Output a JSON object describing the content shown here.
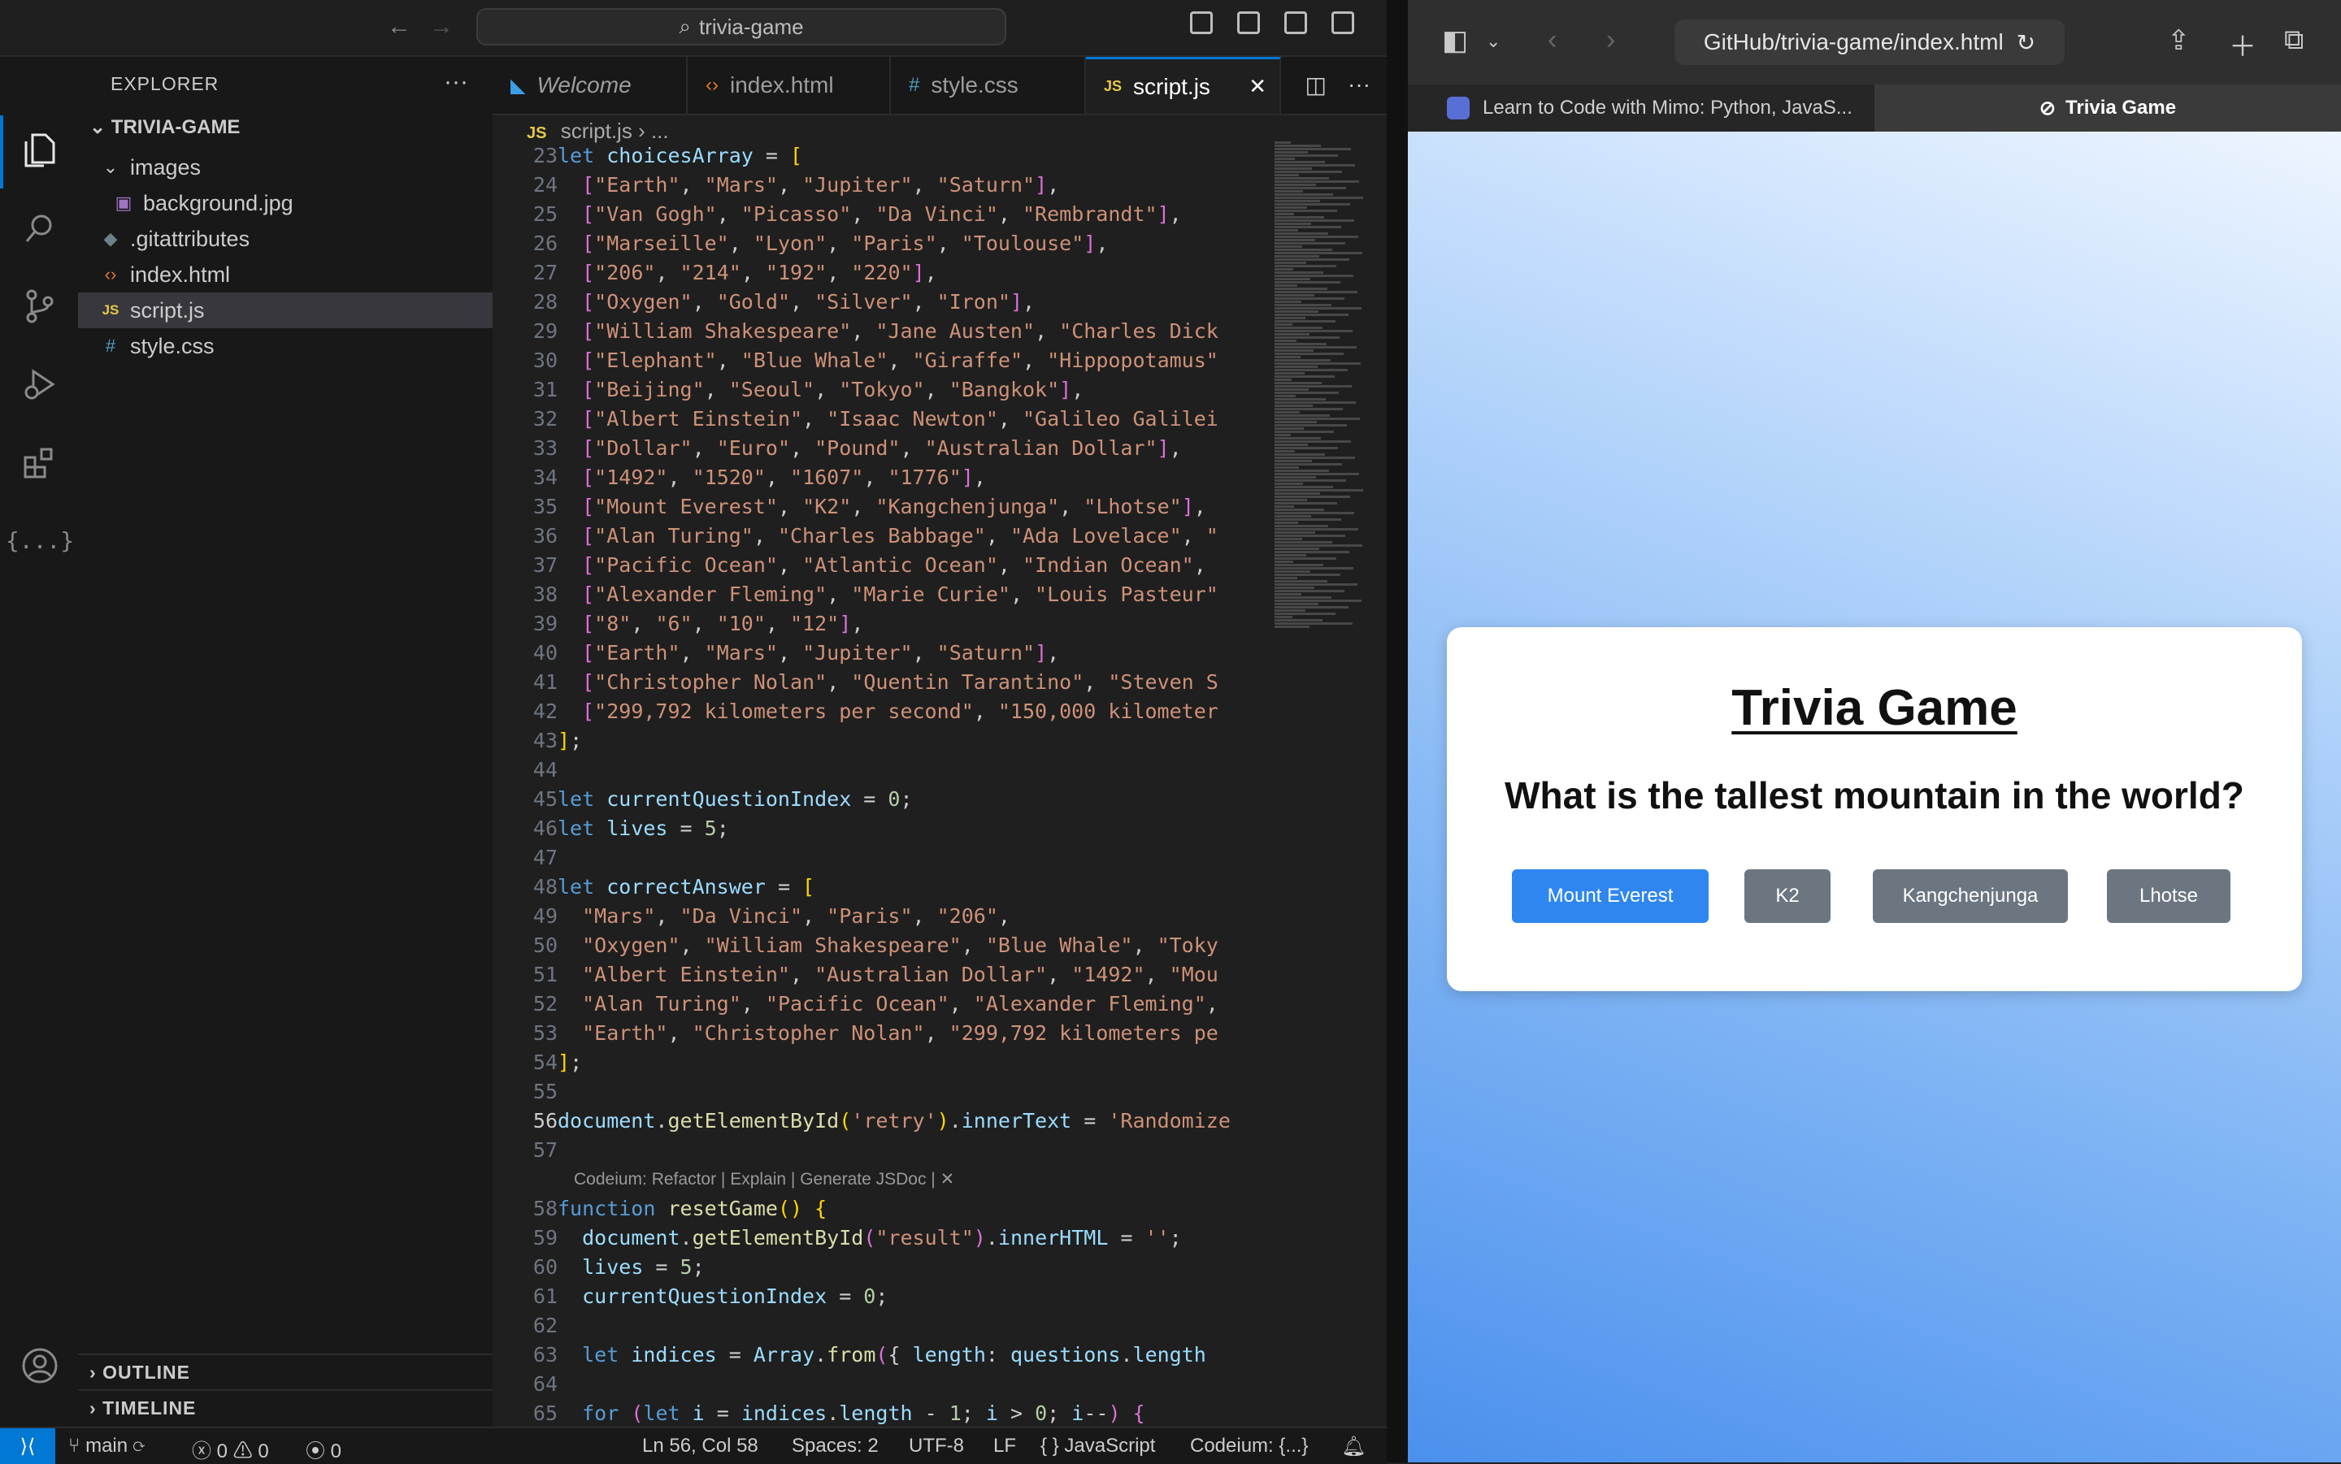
{
  "vscode": {
    "command_center": "trivia-game",
    "explorer_title": "EXPLORER",
    "project_name": "TRIVIA-GAME",
    "tree": [
      {
        "label": "images",
        "kind": "folder"
      },
      {
        "label": "background.jpg",
        "kind": "image"
      },
      {
        "label": ".gitattributes",
        "kind": "git"
      },
      {
        "label": "index.html",
        "kind": "html"
      },
      {
        "label": "script.js",
        "kind": "js"
      },
      {
        "label": "style.css",
        "kind": "css"
      }
    ],
    "outline_label": "OUTLINE",
    "timeline_label": "TIMELINE",
    "tabs": [
      {
        "label": "Welcome",
        "icon": "vscode-icon"
      },
      {
        "label": "index.html",
        "icon": "html-icon"
      },
      {
        "label": "style.css",
        "icon": "css-icon"
      },
      {
        "label": "script.js",
        "icon": "js-icon"
      }
    ],
    "breadcrumb": [
      "script.js",
      "..."
    ],
    "line_numbers": [
      "23",
      "24",
      "25",
      "26",
      "27",
      "28",
      "29",
      "30",
      "31",
      "32",
      "33",
      "34",
      "35",
      "36",
      "37",
      "38",
      "39",
      "40",
      "41",
      "42",
      "43",
      "44",
      "45",
      "46",
      "47",
      "48",
      "49",
      "50",
      "51",
      "52",
      "53",
      "54",
      "55",
      "56",
      "57",
      "",
      "58",
      "59",
      "60",
      "61",
      "62",
      "63",
      "64",
      "65"
    ],
    "codelens": "Codeium: Refactor | Explain | Generate JSDoc | ✕",
    "status": {
      "branch": "main",
      "errors": "0",
      "warnings": "0",
      "ports": "0",
      "position": "Ln 56, Col 58",
      "spaces": "Spaces: 2",
      "encoding": "UTF-8",
      "eol": "LF",
      "language": "JavaScript",
      "codeium": "Codeium: {...}"
    }
  },
  "safari": {
    "url": "GitHub/trivia-game/index.html",
    "tabs": [
      {
        "label": "Learn to Code with Mimo: Python, JavaS..."
      },
      {
        "label": "Trivia Game"
      }
    ],
    "page": {
      "title": "Trivia Game",
      "question": "What is the tallest mountain in the world?",
      "choices": [
        "Mount Everest",
        "K2",
        "Kangchenjunga",
        "Lhotse"
      ]
    }
  },
  "colors": {
    "accent": "#0078d4",
    "primary_button": "#2f86f0",
    "secondary_button": "#6c7680"
  }
}
